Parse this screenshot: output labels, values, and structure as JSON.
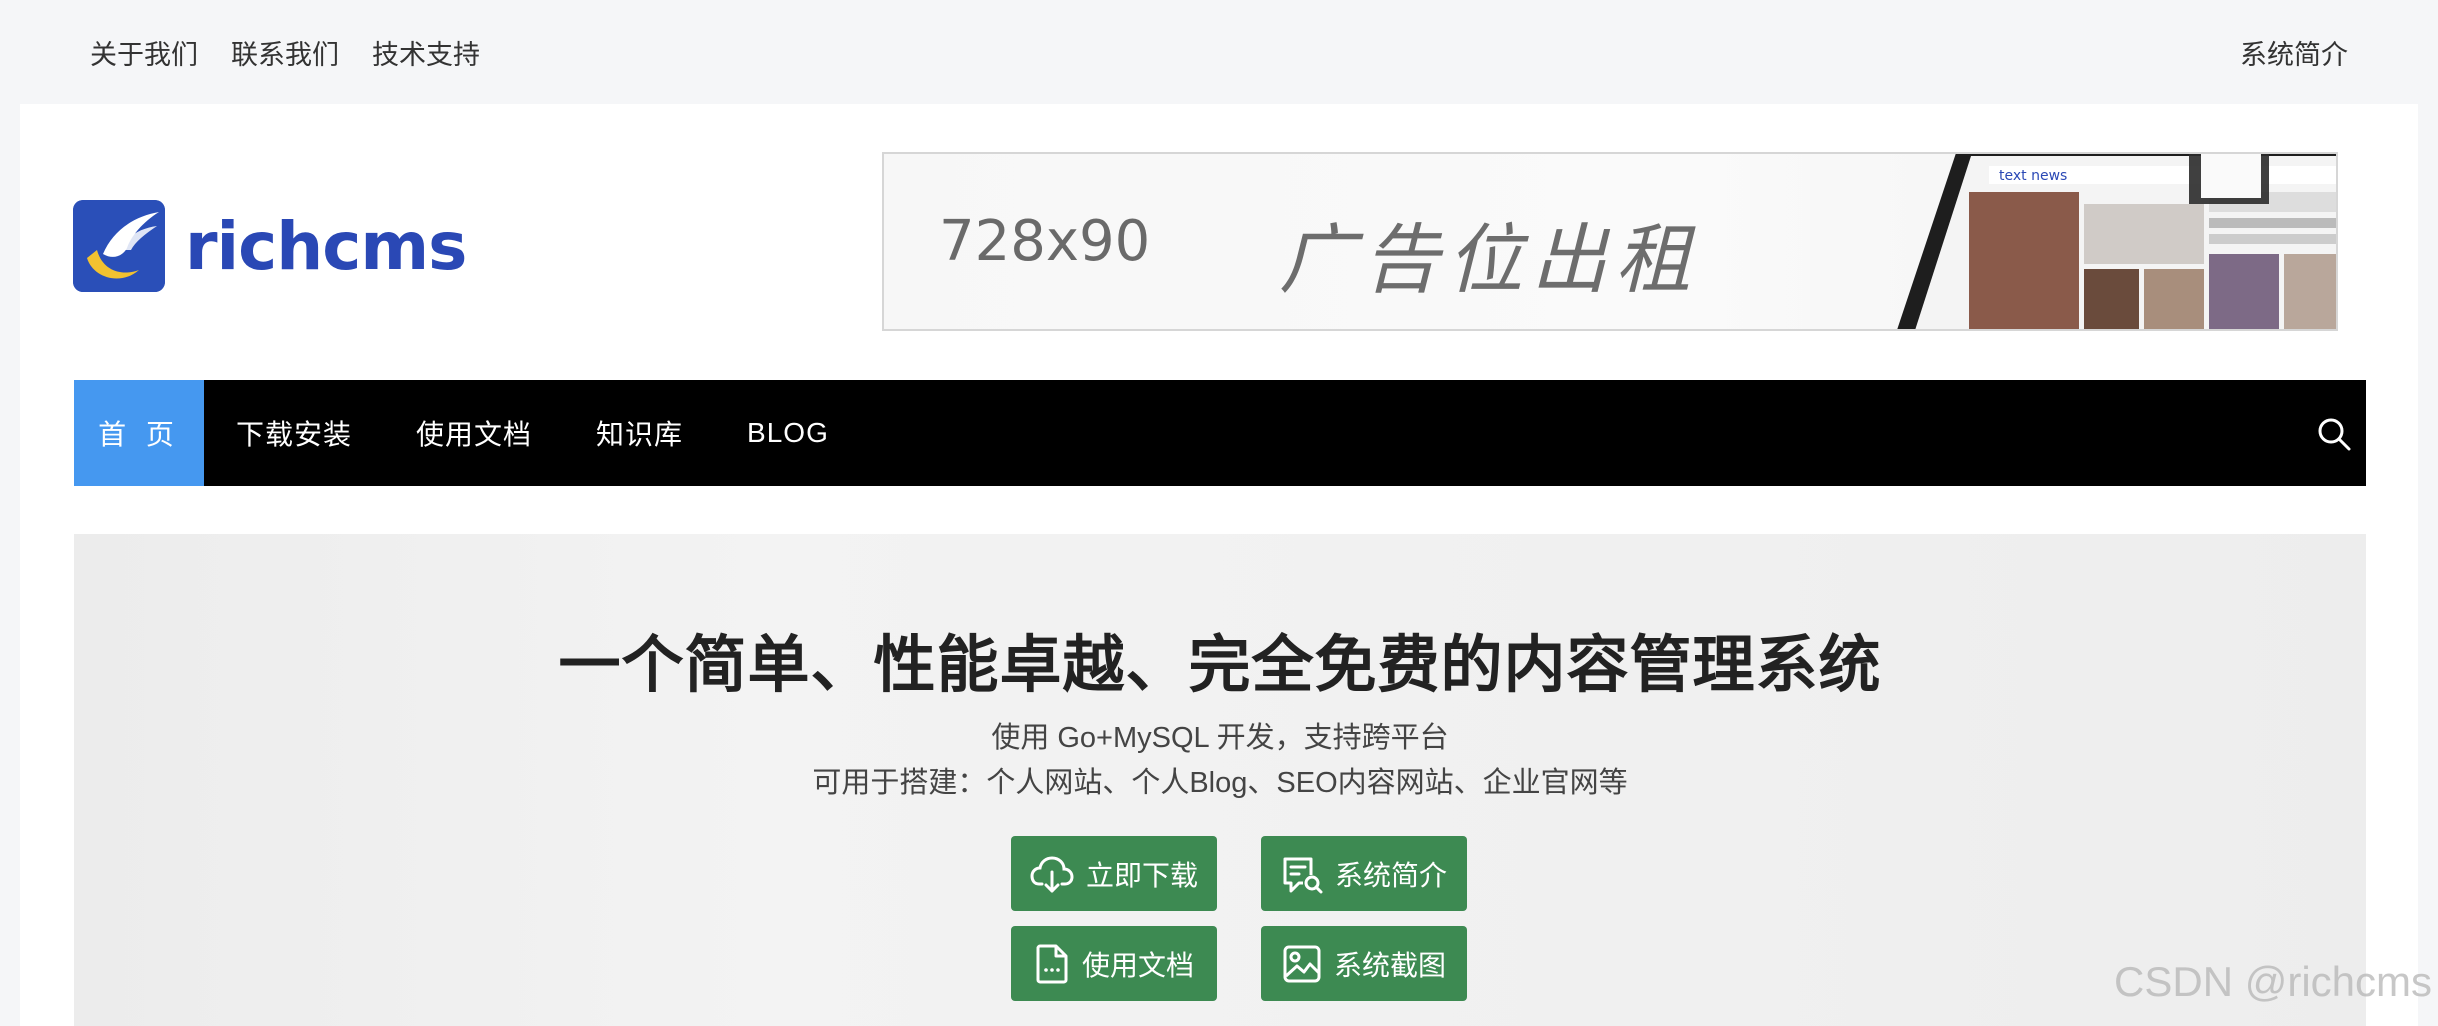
{
  "topbar": {
    "links": [
      "关于我们",
      "联系我们",
      "技术支持"
    ],
    "right_link": "系统简介"
  },
  "logo": {
    "text": "richcms"
  },
  "banner": {
    "size_text": "728x90",
    "text": "广告位出租"
  },
  "nav": {
    "items": [
      "首 页",
      "下载安装",
      "使用文档",
      "知识库",
      "BLOG"
    ],
    "active_index": 0
  },
  "hero": {
    "title": "一个简单、性能卓越、完全免费的内容管理系统",
    "subtitle1": "使用 Go+MySQL 开发，支持跨平台",
    "subtitle2": "可用于搭建：个人网站、个人Blog、SEO内容网站、企业官网等",
    "buttons": {
      "download": "立即下载",
      "intro": "系统简介",
      "docs": "使用文档",
      "screenshots": "系统截图"
    }
  },
  "watermark": "CSDN @richcms",
  "colors": {
    "accent": "#4598f0",
    "nav_bg": "#000000",
    "button_green": "#3d8a52",
    "logo_blue": "#2a48b5"
  }
}
